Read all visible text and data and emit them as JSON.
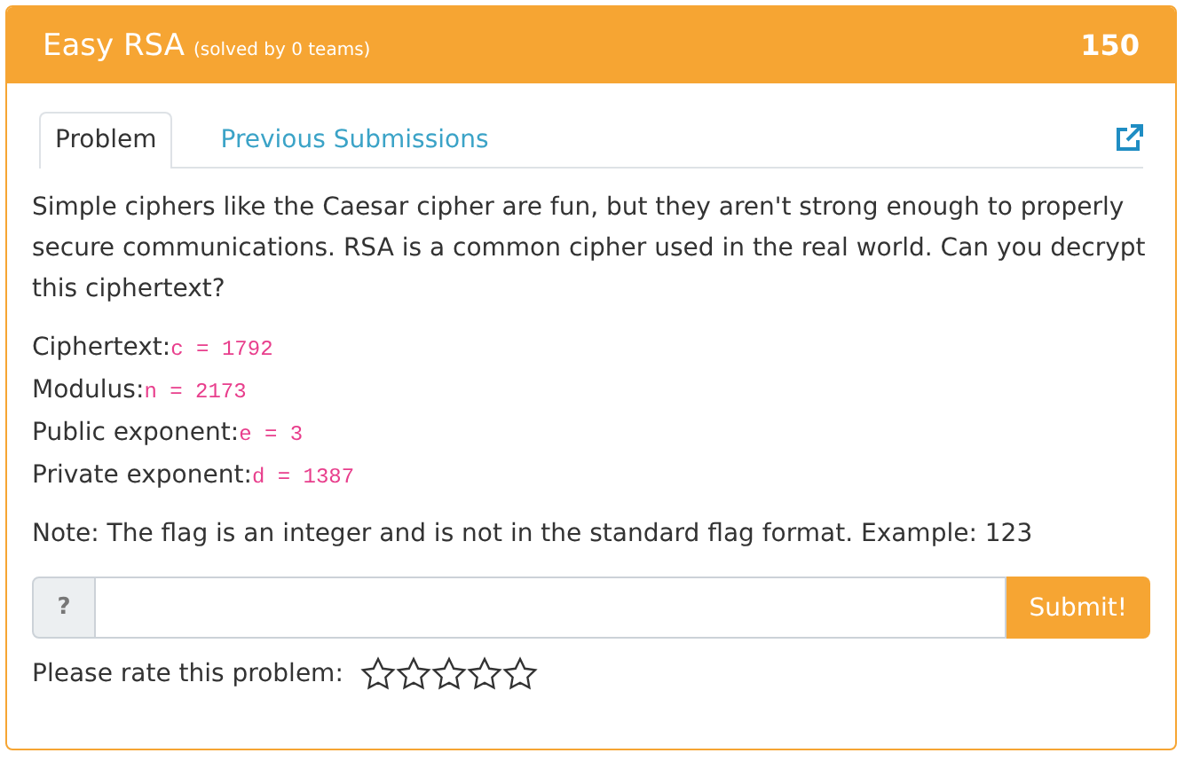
{
  "header": {
    "title": "Easy RSA",
    "subtitle": "(solved by 0 teams)",
    "points": "150"
  },
  "tabs": [
    {
      "label": "Problem",
      "selected": true
    },
    {
      "label": "Previous Submissions",
      "selected": false
    }
  ],
  "description": "Simple ciphers like the Caesar cipher are fun, but they aren't strong enough to properly secure communications. RSA is a common cipher used in the real world. Can you decrypt this ciphertext?",
  "parameters": [
    {
      "label": "Ciphertext:",
      "code": "c = 1792"
    },
    {
      "label": "Modulus:",
      "code": "n = 2173"
    },
    {
      "label": "Public exponent:",
      "code": "e = 3"
    },
    {
      "label": "Private exponent:",
      "code": "d = 1387"
    }
  ],
  "note": "Note: The flag is an integer and is not in the standard flag format. Example: 123",
  "answer": {
    "prefix": "?",
    "submit": "Submit!"
  },
  "rating": {
    "label": "Please rate this problem:",
    "stars": 0
  }
}
